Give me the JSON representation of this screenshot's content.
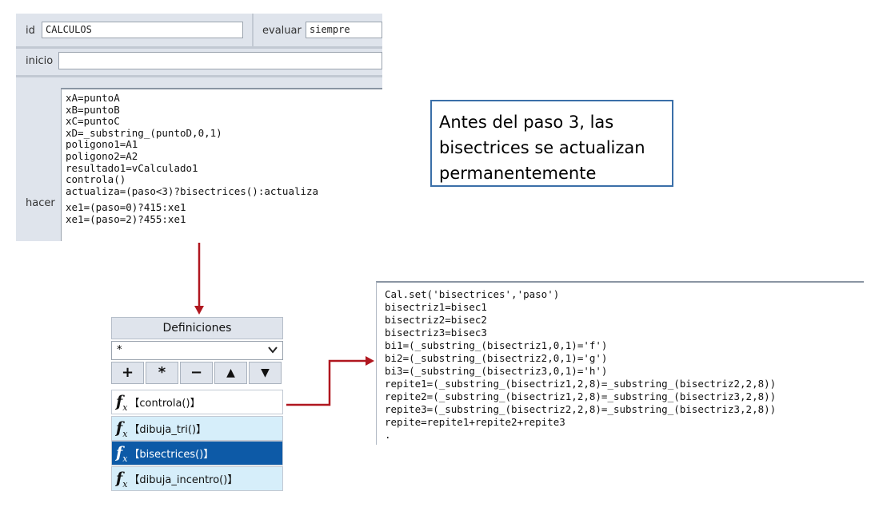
{
  "editor": {
    "id_label": "id",
    "id_value": "CALCULOS",
    "evaluar_label": "evaluar",
    "evaluar_value": "siempre",
    "inicio_label": "inicio",
    "hacer_label": "hacer",
    "code_lines": [
      "xA=puntoA",
      "xB=puntoB",
      "xC=puntoC",
      "xD=_substring_(puntoD,0,1)",
      "poligono1=A1",
      "poligono2=A2",
      "resultado1=vCalculado1",
      "controla()",
      "actualiza=(paso<3)?bisectrices():actualiza",
      "",
      "xe1=(paso=0)?415:xe1",
      "xe1=(paso=2)?455:xe1"
    ]
  },
  "callout": {
    "lines": [
      "Antes del paso 3, las",
      "bisectrices se actualizan",
      "permanentemente"
    ]
  },
  "definitions": {
    "title": "Definiciones",
    "filter_value": "*",
    "buttons": [
      "+",
      "*",
      "−",
      "▲",
      "▼"
    ],
    "items": [
      "【controla()】",
      "【dibuja_tri()】",
      "【bisectrices()】",
      "【dibuja_incentro()】"
    ],
    "selected_index": 2
  },
  "function_code": {
    "lines": [
      "Cal.set('bisectrices','paso')",
      "bisectriz1=bisec1",
      "bisectriz2=bisec2",
      "bisectriz3=bisec3",
      "bi1=(_substring_(bisectriz1,0,1)='f')",
      "bi2=(_substring_(bisectriz2,0,1)='g')",
      "bi3=(_substring_(bisectriz3,0,1)='h')",
      "repite1=(_substring_(bisectriz1,2,8)=_substring_(bisectriz2,2,8))",
      "repite2=(_substring_(bisectriz1,2,8)=_substring_(bisectriz3,2,8))",
      "repite3=(_substring_(bisectriz2,2,8)=_substring_(bisectriz3,2,8))",
      "repite=repite1+repite2+repite3",
      "."
    ]
  },
  "colors": {
    "arrow": "#b0171f",
    "accent": "#0d5aa7",
    "callout_border": "#3a6fa8"
  }
}
